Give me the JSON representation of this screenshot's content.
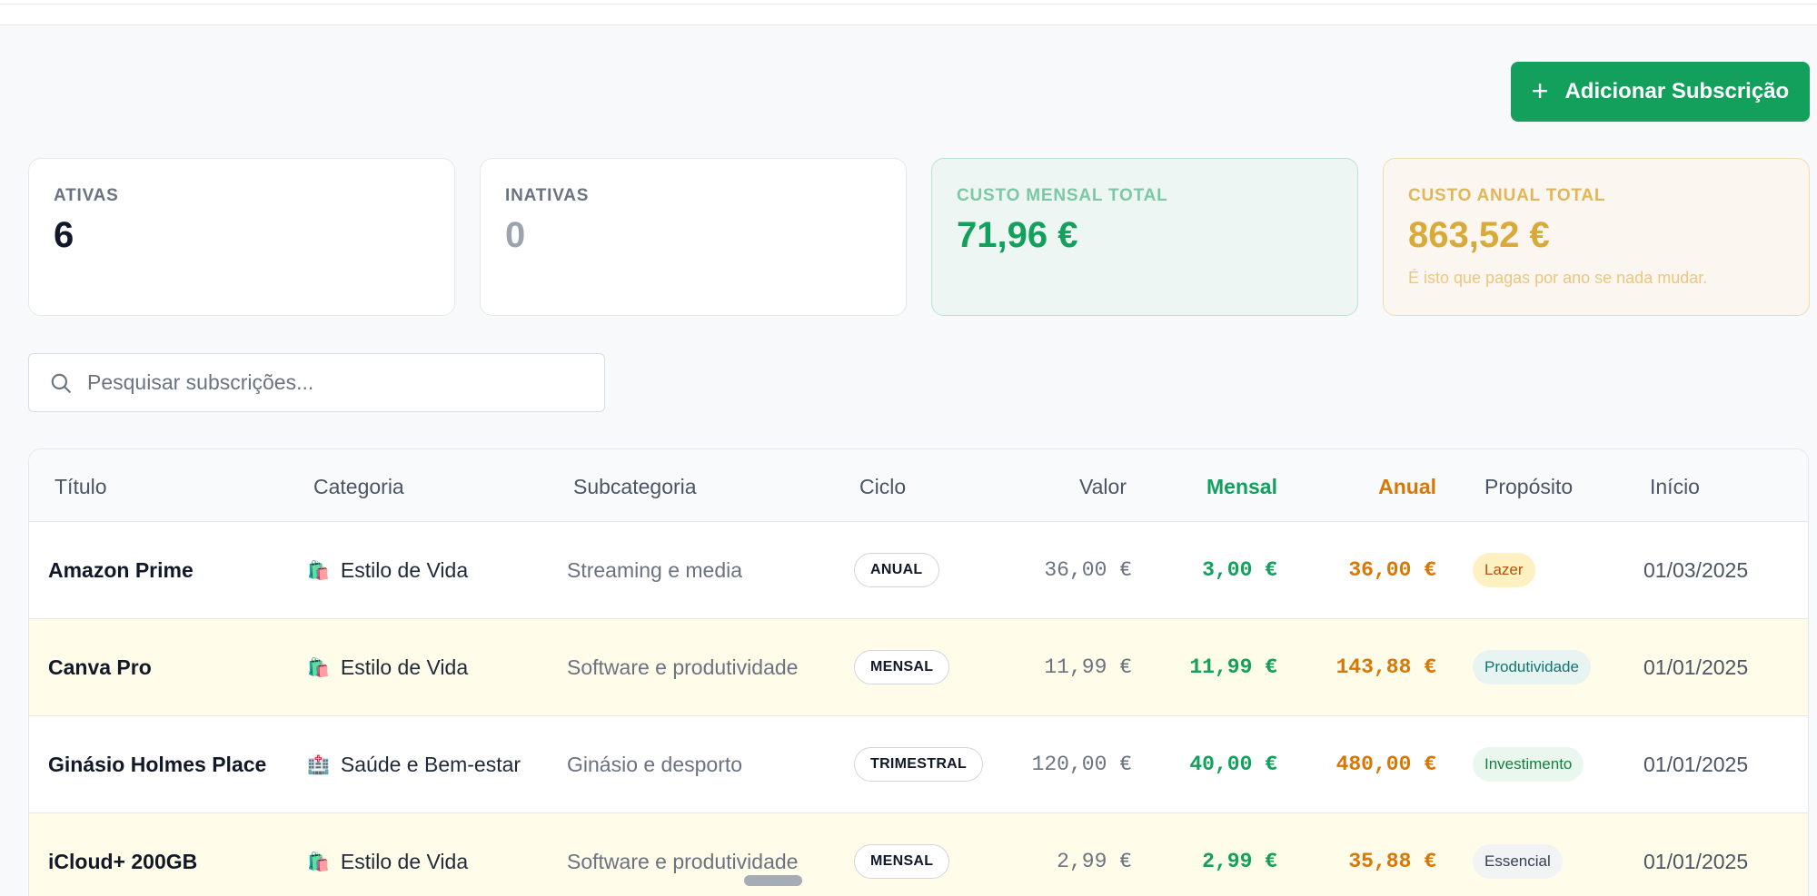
{
  "header": {
    "add_button_label": "Adicionar Subscrição"
  },
  "stats": {
    "active": {
      "label": "ATIVAS",
      "value": "6"
    },
    "inactive": {
      "label": "INATIVAS",
      "value": "0"
    },
    "monthly": {
      "label": "CUSTO MENSAL TOTAL",
      "value": "71,96 €"
    },
    "annual": {
      "label": "CUSTO ANUAL TOTAL",
      "value": "863,52 €",
      "hint": "É isto que pagas por ano se nada mudar."
    }
  },
  "search": {
    "placeholder": "Pesquisar subscrições..."
  },
  "table": {
    "columns": {
      "title": "Título",
      "category": "Categoria",
      "subcategory": "Subcategoria",
      "cycle": "Ciclo",
      "value": "Valor",
      "monthly": "Mensal",
      "annual": "Anual",
      "purpose": "Propósito",
      "start": "Início"
    },
    "rows": [
      {
        "title": "Amazon Prime",
        "category_icon": "🛍️",
        "category": "Estilo de Vida",
        "subcategory": "Streaming e media",
        "cycle": "ANUAL",
        "value": "36,00 €",
        "monthly": "3,00 €",
        "annual": "36,00 €",
        "purpose": "Lazer",
        "start": "01/03/2025"
      },
      {
        "title": "Canva Pro",
        "category_icon": "🛍️",
        "category": "Estilo de Vida",
        "subcategory": "Software e produtividade",
        "cycle": "MENSAL",
        "value": "11,99 €",
        "monthly": "11,99 €",
        "annual": "143,88 €",
        "purpose": "Produtividade",
        "start": "01/01/2025"
      },
      {
        "title": "Ginásio Holmes Place",
        "category_icon": "🏥",
        "category": "Saúde e Bem-estar",
        "subcategory": "Ginásio e desporto",
        "cycle": "TRIMESTRAL",
        "value": "120,00 €",
        "monthly": "40,00 €",
        "annual": "480,00 €",
        "purpose": "Investimento",
        "start": "01/01/2025"
      },
      {
        "title": "iCloud+ 200GB",
        "category_icon": "🛍️",
        "category": "Estilo de Vida",
        "subcategory": "Software e produtividade",
        "cycle": "MENSAL",
        "value": "2,99 €",
        "monthly": "2,99 €",
        "annual": "35,88 €",
        "purpose": "Essencial",
        "start": "01/01/2025"
      }
    ]
  },
  "colors": {
    "accent_green": "#12a05c",
    "annual_orange": "#d97706",
    "gold": "#d9a93a"
  },
  "icons": {
    "search": "search-icon",
    "add": "plus-icon"
  }
}
